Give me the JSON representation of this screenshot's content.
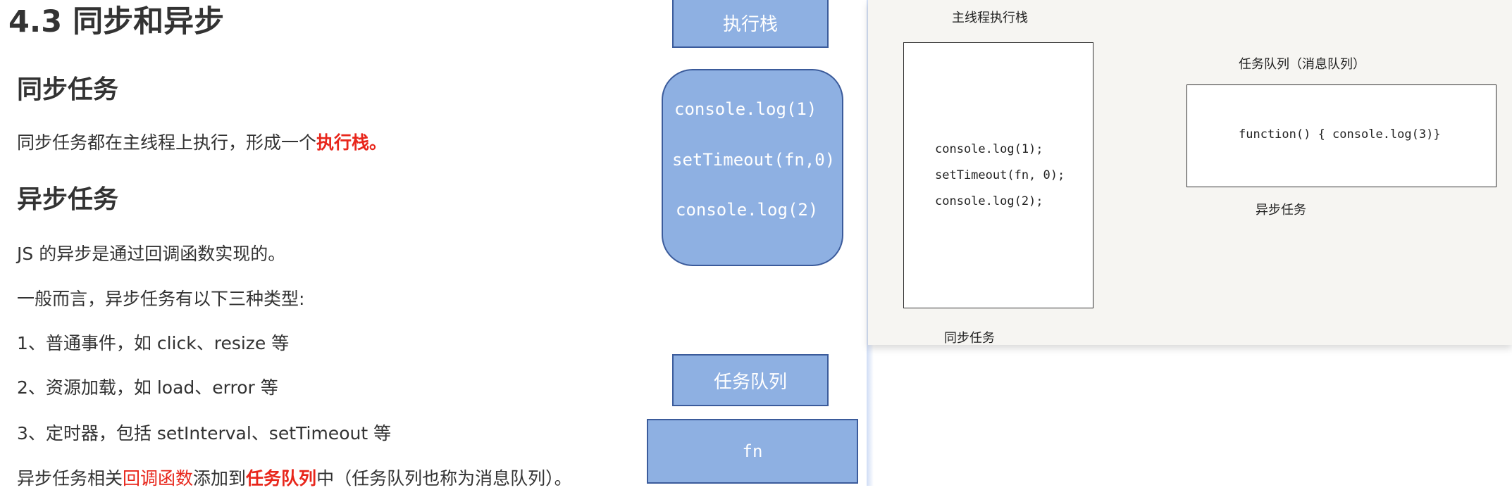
{
  "doc": {
    "title": "4.3 同步和异步",
    "sync_heading": "同步任务",
    "sync_desc_prefix": "同步任务都在主线程上执行，形成一个",
    "sync_desc_highlight": "执行栈。",
    "async_heading": "异步任务",
    "async_p1": "JS 的异步是通过回调函数实现的。",
    "async_p2": "一般而言，异步任务有以下三种类型:",
    "async_item1": "1、普通事件，如 click、resize 等",
    "async_item2": "2、资源加载，如 load、error 等",
    "async_item3": "3、定时器，包括 setInterval、setTimeout 等",
    "last_prefix": "异步任务相关",
    "last_red": "回调函数",
    "last_mid": "添加到",
    "last_redb": "任务队列",
    "last_suffix": "中（任务队列也称为消息队列）。"
  },
  "diagram": {
    "exec_stack_label": "执行栈",
    "stack_lines": [
      "console.log(1)",
      "setTimeout(fn,0)",
      "console.log(2)"
    ],
    "task_queue_label": "任务队列",
    "fn_label": "fn"
  },
  "right": {
    "main_thread_label": "主线程执行栈",
    "code_lines": [
      "console.log(1);",
      "setTimeout(fn, 0);",
      "console.log(2);"
    ],
    "sync_label": "同步任务",
    "queue_label": "任务队列（消息队列）",
    "queue_code": "function() {  console.log(3)}",
    "async_label": "异步任务"
  },
  "colors": {
    "accent_red": "#e8261b",
    "box_blue": "#8eb0e2",
    "box_border": "#3b5b9b"
  }
}
